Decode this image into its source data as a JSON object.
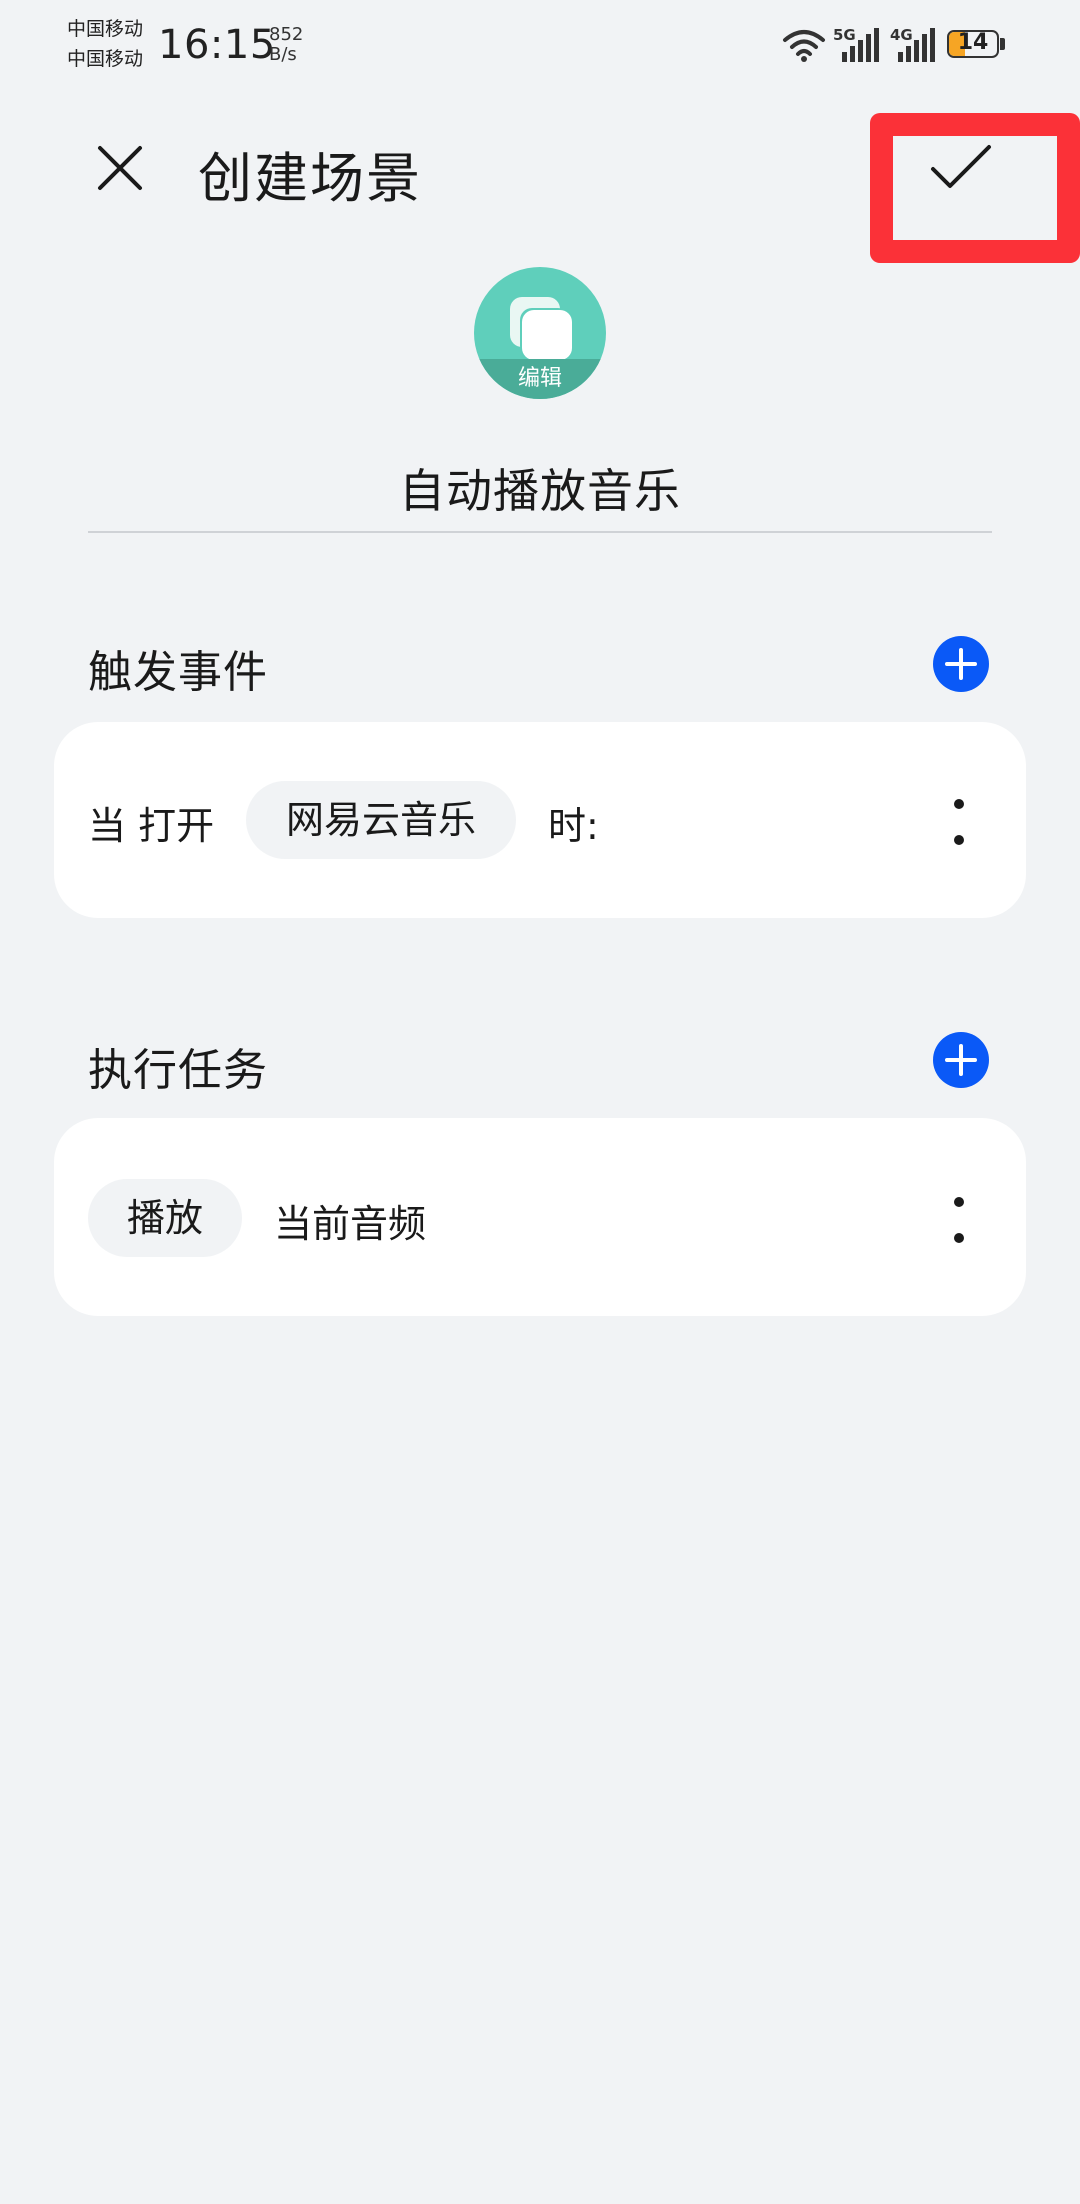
{
  "status_bar": {
    "carrier_1": "中国移动",
    "carrier_2": "中国移动",
    "time": "16:15",
    "net_speed_value": "852",
    "net_speed_unit": "B/s",
    "signal_1_label": "5G",
    "signal_2_label": "4G",
    "battery_level": "14",
    "battery_color": "#f6a524"
  },
  "header": {
    "close_icon": "close-icon",
    "title": "创建场景",
    "confirm_icon": "check-icon",
    "highlight_color": "#fb3138"
  },
  "scene": {
    "avatar_edit_label": "编辑",
    "avatar_color": "#5fcfbb",
    "name": "自动播放音乐"
  },
  "trigger_section": {
    "title": "触发事件",
    "add_icon": "plus-icon",
    "item": {
      "prefix": "当 打开",
      "app_chip": "网易云音乐",
      "suffix": "时:",
      "more_icon": "more-vertical-icon"
    }
  },
  "task_section": {
    "title": "执行任务",
    "add_icon": "plus-icon",
    "item": {
      "action_chip": "播放",
      "target": "当前音频",
      "more_icon": "more-vertical-icon"
    }
  },
  "accent_color": "#0a59f7"
}
